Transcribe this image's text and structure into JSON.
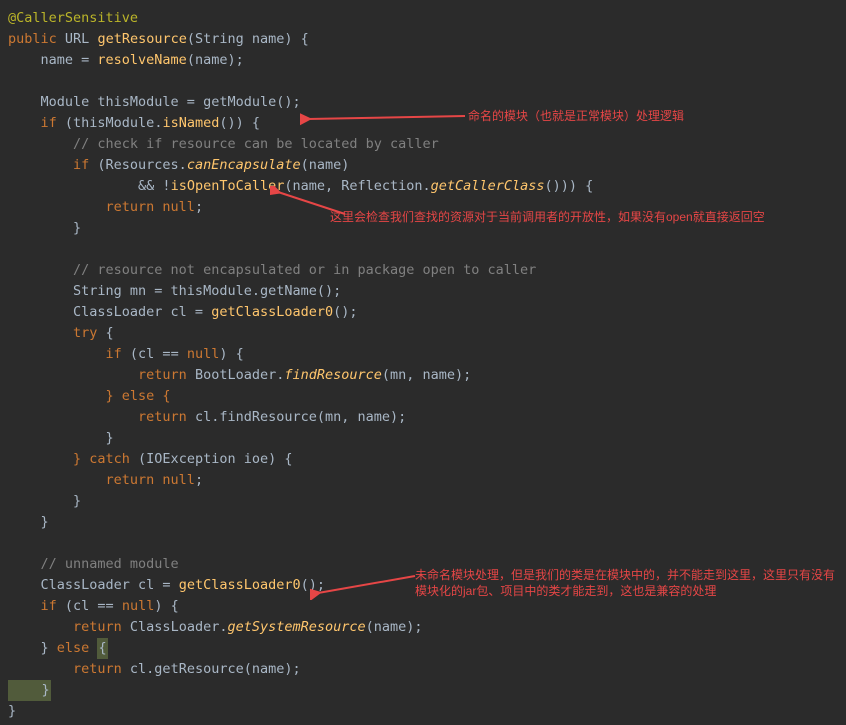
{
  "code": {
    "a": "@CallerSensitive",
    "l1_kw1": "public",
    "l1_type": "URL",
    "l1_fn": "getResource",
    "l1_arg": "(String name) {",
    "l2a": "    name = ",
    "l2fn": "resolveName",
    "l2b": "(name);",
    "l4": "    Module thisModule = getModule();",
    "l5kw": "    if",
    "l5a": " (thisModule.",
    "l5fn": "isNamed",
    "l5b": "()) {",
    "lcmt1": "        // check if resource can be located by caller",
    "l7kw": "        if",
    "l7a": " (Resources.",
    "l7fn": "canEncapsulate",
    "l7b": "(name)",
    "l8a": "                && !",
    "l8fn": "isOpenToCaller",
    "l8b": "(name, Reflection.",
    "l8fn2": "getCallerClass",
    "l8c": "())) {",
    "l9kw": "            return null",
    "l9b": ";",
    "l10": "        }",
    "lcmt2": "        // resource not encapsulated or in package open to caller",
    "l12": "        String mn = thisModule.getName();",
    "l13a": "        ClassLoader cl = ",
    "l13fn": "getClassLoader0",
    "l13b": "();",
    "l14kw": "        try",
    "l14b": " {",
    "l15kw": "            if",
    "l15a": " (cl == ",
    "l15kw2": "null",
    "l15b": ") {",
    "l16kw": "                return",
    "l16a": " BootLoader.",
    "l16fn": "findResource",
    "l16b": "(mn, name);",
    "l17kw": "            } else {",
    "l18kw": "                return",
    "l18a": " cl.findResource(mn, name);",
    "l19": "            }",
    "l20kw": "        } catch",
    "l20a": " (IOException ioe) {",
    "l21kw": "            return null",
    "l21b": ";",
    "l22": "        }",
    "l23": "    }",
    "lcmt3": "    // unnamed module",
    "l25a": "    ClassLoader cl = ",
    "l25fn": "getClassLoader0",
    "l25b": "();",
    "l26kw": "    if",
    "l26a": " (cl == ",
    "l26kw2": "null",
    "l26b": ") {",
    "l27kw": "        return",
    "l27a": " ClassLoader.",
    "l27fn": "getSystemResource",
    "l27b": "(name);",
    "l28a": "    } ",
    "l28kw": "else",
    "l28b": " ",
    "l28hl": "{",
    "l29kw": "        return",
    "l29a": " cl.getResource(name);",
    "l30hl": "    }",
    "l31": "}"
  },
  "annotations": {
    "a1": "命名的模块（也就是正常模块）处理逻辑",
    "a2": "这里会检查我们查找的资源对于当前调用者的开放性，如果没有open就直接返回空",
    "a3": "未命名模块处理，但是我们的类是在模块中的，并不能走到这里，这里只有没有模块化的jar包、项目中的类才能走到，这也是兼容的处理"
  }
}
